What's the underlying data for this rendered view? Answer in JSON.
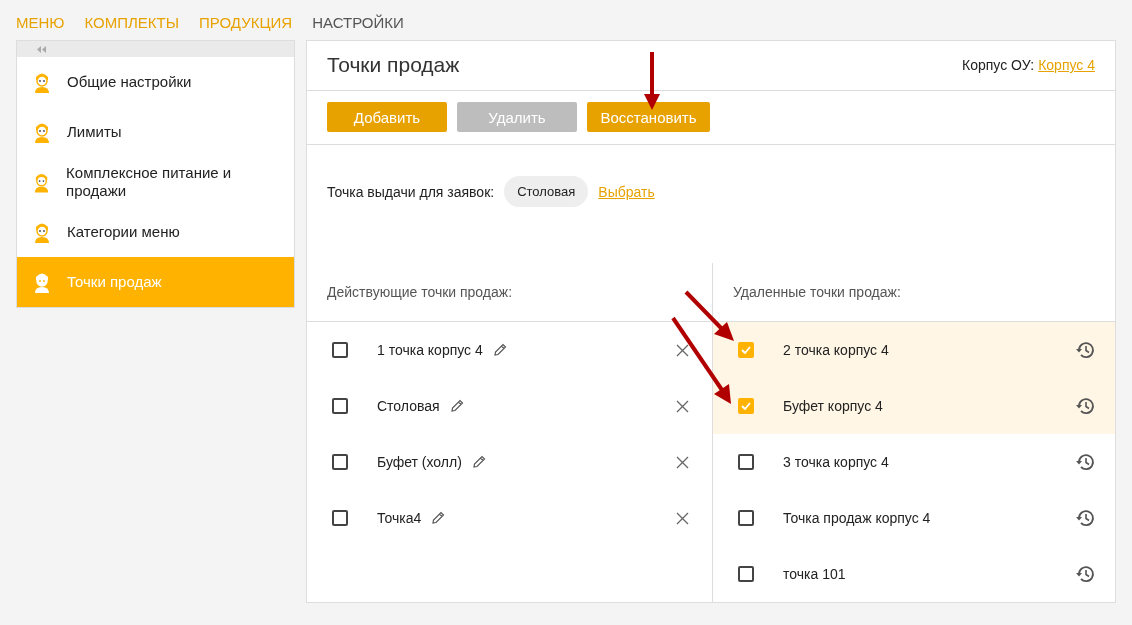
{
  "top_nav": [
    {
      "label": "МЕНЮ",
      "selected": false
    },
    {
      "label": "КОМПЛЕКТЫ",
      "selected": false
    },
    {
      "label": "ПРОДУКЦИЯ",
      "selected": false
    },
    {
      "label": "НАСТРОЙКИ",
      "selected": true
    }
  ],
  "sidebar": {
    "items": [
      {
        "label": "Общие настройки",
        "selected": false
      },
      {
        "label": "Лимиты",
        "selected": false
      },
      {
        "label": "Комплексное питание и продажи",
        "selected": false
      },
      {
        "label": "Категории меню",
        "selected": false
      },
      {
        "label": "Точки продаж",
        "selected": true
      }
    ]
  },
  "panel": {
    "title": "Точки продаж",
    "building_label": "Корпус ОУ:",
    "building_link": "Корпус 4",
    "buttons": [
      {
        "label": "Добавить",
        "disabled": false
      },
      {
        "label": "Удалить",
        "disabled": true
      },
      {
        "label": "Восстановить",
        "disabled": false
      }
    ],
    "pickup_label": "Точка выдачи для заявок:",
    "pickup_value": "Столовая",
    "pickup_link": "Выбрать",
    "active_title": "Действующие точки продаж:",
    "active_points": [
      {
        "name": "1 точка корпус 4",
        "checked": false
      },
      {
        "name": "Столовая",
        "checked": false
      },
      {
        "name": "Буфет (холл)",
        "checked": false
      },
      {
        "name": "Точка4",
        "checked": false
      }
    ],
    "deleted_title": "Удаленные точки продаж:",
    "deleted_points": [
      {
        "name": "2 точка корпус 4",
        "checked": true
      },
      {
        "name": "Буфет корпус 4",
        "checked": true
      },
      {
        "name": "3 точка корпус 4",
        "checked": false
      },
      {
        "name": "Точка продаж корпус 4",
        "checked": false
      },
      {
        "name": "точка 101",
        "checked": false
      }
    ]
  }
}
